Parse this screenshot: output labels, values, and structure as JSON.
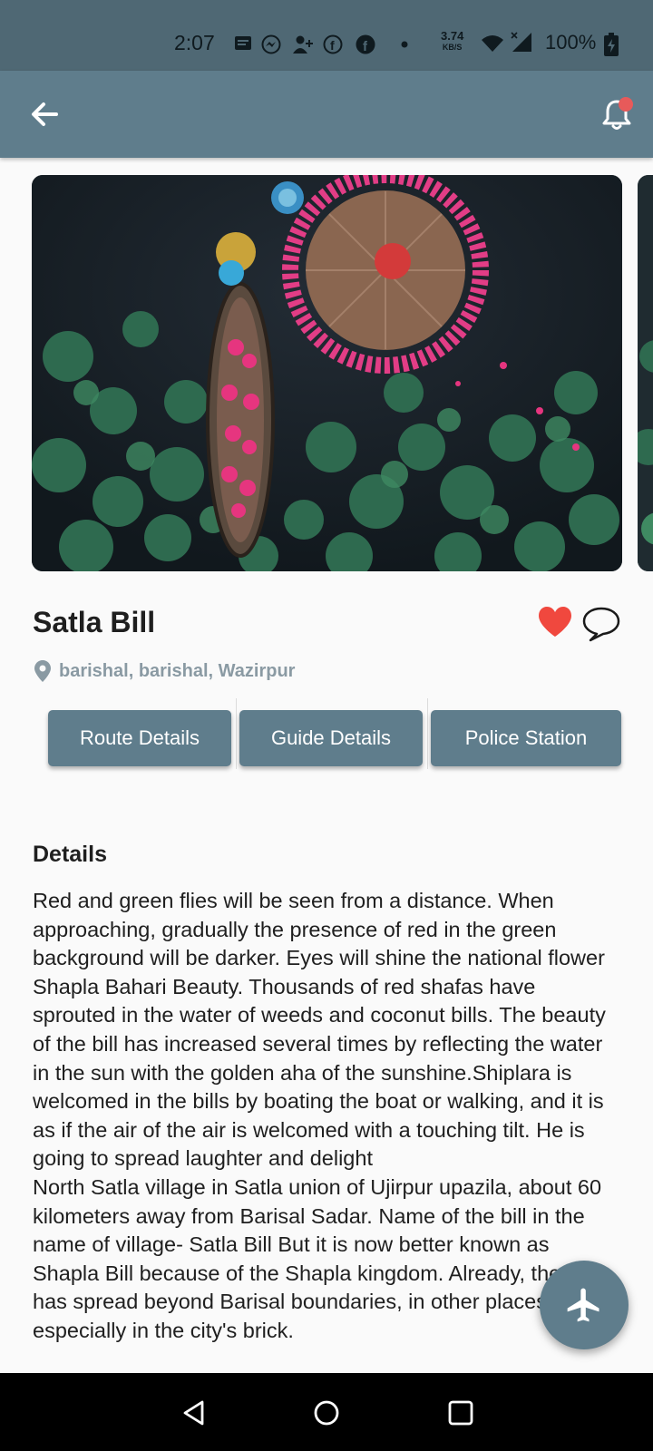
{
  "status_bar": {
    "time": "2:07",
    "network_speed": "3.74",
    "network_unit": "KB/S",
    "battery": "100%",
    "icons": [
      "message-icon",
      "messenger-icon",
      "person-add-icon",
      "facebook-icon",
      "facebook-icon",
      "dot-icon",
      "wifi-icon",
      "signal-icon",
      "battery-charging-icon"
    ]
  },
  "app_bar": {
    "back_icon": "arrow-left-icon",
    "notification_icon": "bell-icon",
    "notification_badge_color": "#e75a5a"
  },
  "place": {
    "title": "Satla Bill",
    "location": "barishal, barishal, Wazirpur",
    "favorite_color": "#f0483e"
  },
  "actions": {
    "route": "Route Details",
    "guide": "Guide Details",
    "police": "Police Station"
  },
  "details": {
    "heading": "Details",
    "body": "Red and green flies will be seen from a distance. When approaching, gradually the presence of red in the green background will be darker. Eyes will shine the national flower Shapla Bahari Beauty. Thousands of red shafas have sprouted in the water of weeds and coconut bills. The beauty of the bill has increased several times by reflecting the water in the sun with the golden aha of the sunshine.Shiplara is welcomed in the bills by boating the boat or walking, and it is as if the air of the air is welcomed with a touching tilt. He is going to spread laughter and delight\nNorth Satla village in Satla union of Ujirpur upazila, about 60 kilometers away from Barisal Sadar. Name of the bill in the name of village- Satla Bill But it is now better known as Shapla Bill because of the Shapla kingdom. Already, the bill has spread beyond Barisal boundaries, in other places, especially in the city's brick."
  },
  "fab": {
    "icon": "airplane-icon"
  },
  "colors": {
    "primary": "#5f7d8c",
    "status_bar": "#4f6874"
  }
}
